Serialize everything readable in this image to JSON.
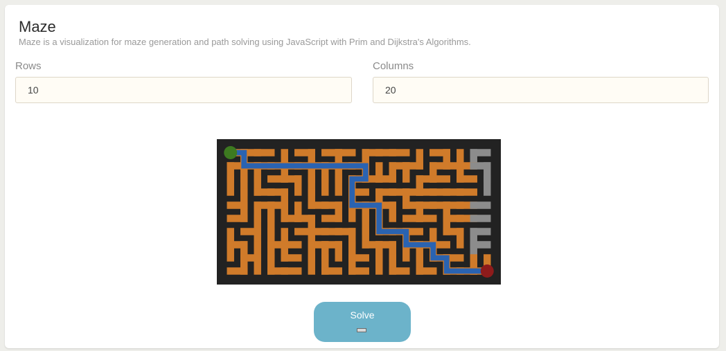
{
  "header": {
    "title": "Maze",
    "subtitle": "Maze is a visualization for maze generation and path solving using JavaScript with Prim and Dijkstra's Algorithms."
  },
  "form": {
    "rows_label": "Rows",
    "rows_value": "10",
    "columns_label": "Columns",
    "columns_value": "20"
  },
  "maze": {
    "rows": 10,
    "columns": 20,
    "start": "top-left",
    "end": "bottom-right",
    "colors": {
      "background": "#222222",
      "path": "#d07b2a",
      "unvisited": "#8c8c8c",
      "solution": "#2a63b1",
      "start_marker": "#3d7a20",
      "end_marker": "#8e1b1b"
    }
  },
  "actions": {
    "solve_label": "Solve",
    "solve_icon": "flag-icon"
  }
}
